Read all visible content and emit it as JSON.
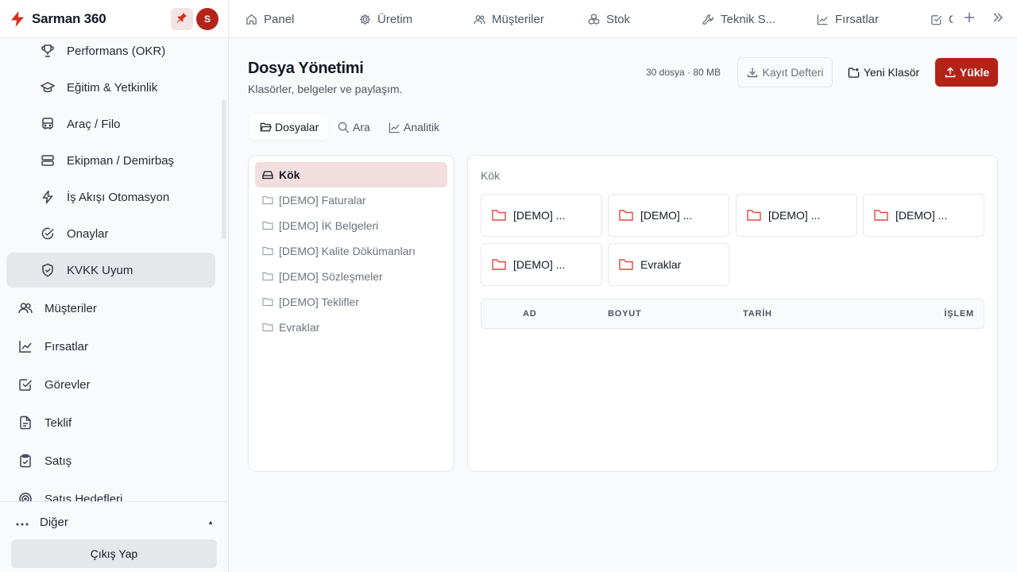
{
  "brand": {
    "name": "Sarman 360",
    "avatar_initial": "S"
  },
  "sidebar": {
    "sub_items": [
      {
        "label": "Performans (OKR)",
        "icon": "trophy-icon"
      },
      {
        "label": "Eğitim & Yetkinlik",
        "icon": "graduation-cap-icon"
      },
      {
        "label": "Araç / Filo",
        "icon": "bus-icon"
      },
      {
        "label": "Ekipman / Demirbaş",
        "icon": "server-icon"
      },
      {
        "label": "İş Akışı Otomasyon",
        "icon": "bolt-icon"
      },
      {
        "label": "Onaylar",
        "icon": "check-circle-icon"
      },
      {
        "label": "KVKK Uyum",
        "icon": "shield-check-icon",
        "active": true
      }
    ],
    "items": [
      {
        "label": "Müşteriler",
        "icon": "users-icon"
      },
      {
        "label": "Fırsatlar",
        "icon": "trending-up-icon"
      },
      {
        "label": "Görevler",
        "icon": "check-square-icon"
      },
      {
        "label": "Teklif",
        "icon": "file-text-icon"
      },
      {
        "label": "Satış",
        "icon": "clipboard-check-icon"
      },
      {
        "label": "Satış Hedefleri",
        "icon": "target-icon"
      }
    ],
    "more_label": "Diğer",
    "logout_label": "Çıkış Yap"
  },
  "topbar": {
    "tabs": [
      {
        "label": "Panel",
        "icon": "home-icon"
      },
      {
        "label": "Üretim",
        "icon": "gear-icon"
      },
      {
        "label": "Müşteriler",
        "icon": "users-icon"
      },
      {
        "label": "Stok",
        "icon": "boxes-icon"
      },
      {
        "label": "Teknik S...",
        "icon": "wrench-icon"
      },
      {
        "label": "Fırsatlar",
        "icon": "trending-up-icon"
      },
      {
        "label": "G",
        "icon": "check-square-icon"
      }
    ]
  },
  "header": {
    "title": "Dosya Yönetimi",
    "subtitle": "Klasörler, belgeler ve paylaşım.",
    "stats": "30 dosya · 80 MB",
    "log_button": "Kayıt Defteri",
    "new_folder_button": "Yeni Klasör",
    "upload_button": "Yükle"
  },
  "tabs": [
    {
      "label": "Dosyalar",
      "active": true
    },
    {
      "label": "Ara"
    },
    {
      "label": "Analitik"
    }
  ],
  "tree": [
    {
      "label": "Kök",
      "active": true
    },
    {
      "label": "[DEMO] Faturalar"
    },
    {
      "label": "[DEMO] İK Belgeleri"
    },
    {
      "label": "[DEMO] Kalite Dökümanları"
    },
    {
      "label": "[DEMO] Sözleşmeler"
    },
    {
      "label": "[DEMO] Teklifler"
    },
    {
      "label": "Evraklar"
    }
  ],
  "content": {
    "breadcrumb": "Kök",
    "folders": [
      "[DEMO] ...",
      "[DEMO] ...",
      "[DEMO] ...",
      "[DEMO] ...",
      "[DEMO] ...",
      "Evraklar"
    ],
    "columns": [
      "AD",
      "BOYUT",
      "TARİH",
      "İŞLEM"
    ]
  },
  "colors": {
    "accent": "#b42318",
    "active_bg": "#f2dede",
    "folder_icon": "#dc4a3f"
  }
}
